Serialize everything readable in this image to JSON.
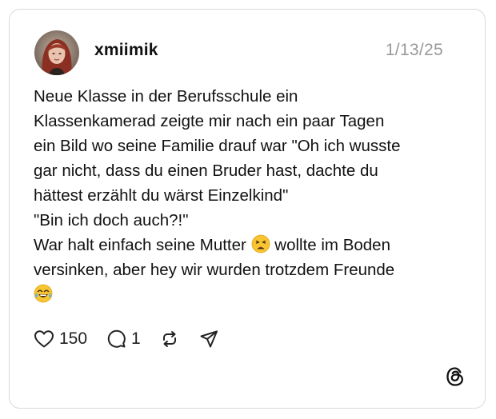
{
  "post": {
    "username": "xmiimik",
    "date": "1/13/25",
    "lines": [
      "Neue Klasse in der Berufsschule ein",
      "Klassenkamerad zeigte mir nach ein paar Tagen",
      "ein Bild wo seine Familie drauf war \"Oh ich wusste",
      "gar nicht, dass du einen Bruder hast, dachte du",
      "hättest erzählt du wärst Einzelkind\"",
      "\"Bin ich doch auch?!\"",
      "War halt einfach seine Mutter",
      "wollte im Boden",
      "versinken, aber hey wir wurden trotzdem Freunde"
    ],
    "emojis": [
      "weary-face-emoji",
      "tears-of-joy-emoji"
    ]
  },
  "actions": {
    "likes": "150",
    "replies": "1",
    "icons": [
      "heart-icon",
      "comment-icon",
      "repost-icon",
      "share-icon"
    ]
  },
  "branding": {
    "logo": "threads-logo-icon"
  },
  "colors": {
    "text": "#111111",
    "muted": "#999999",
    "border": "#d9d9d9"
  }
}
